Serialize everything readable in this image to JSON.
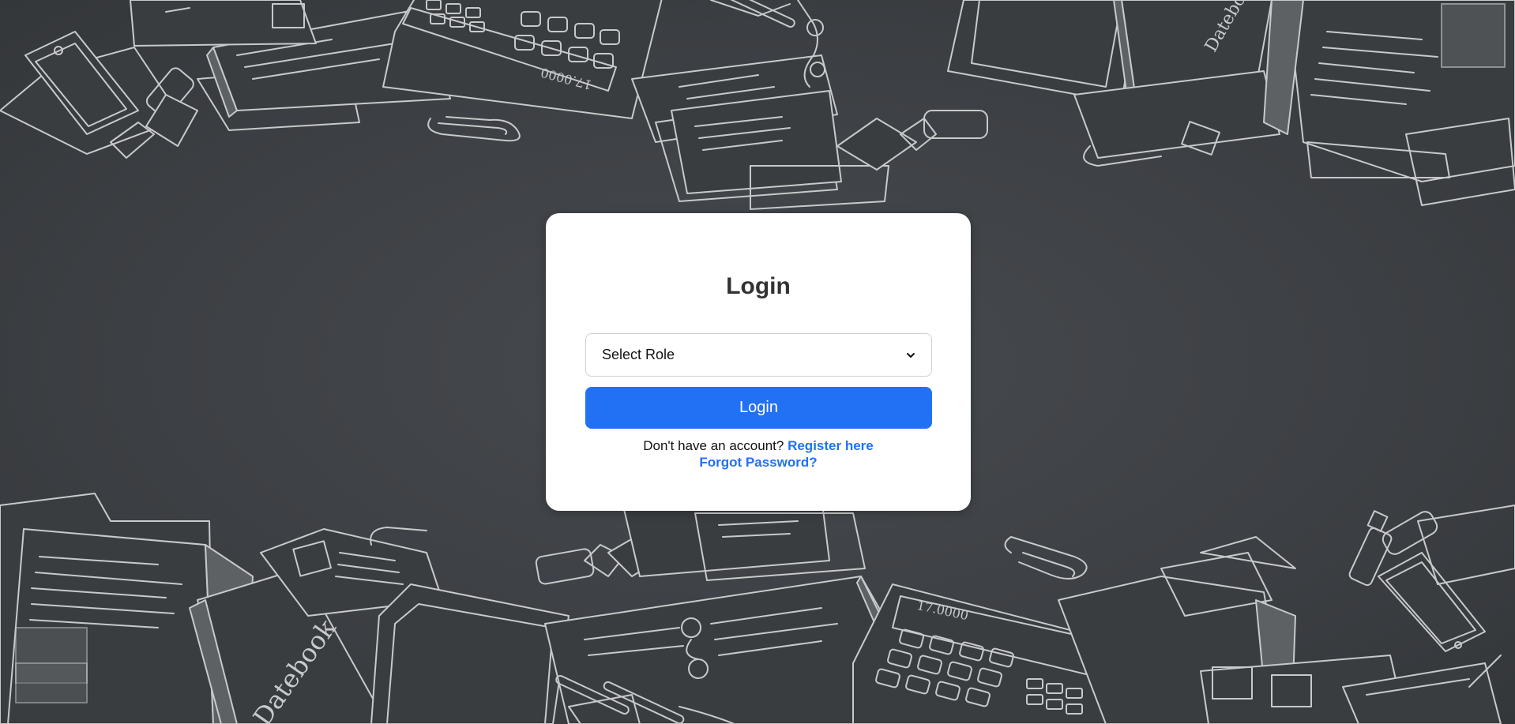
{
  "login_card": {
    "title": "Login",
    "role_select": {
      "selected": "Select Role"
    },
    "login_button_label": "Login",
    "register_prompt": "Don't have an account?",
    "register_link": "Register here",
    "forgot_password_link": "Forgot Password?"
  },
  "background": {
    "notebook_text": "Datebook",
    "calculator_display": "17.0000"
  },
  "colors": {
    "accent": "#2271f5",
    "background": "#3d4044",
    "card": "#ffffff",
    "title": "#333333"
  }
}
